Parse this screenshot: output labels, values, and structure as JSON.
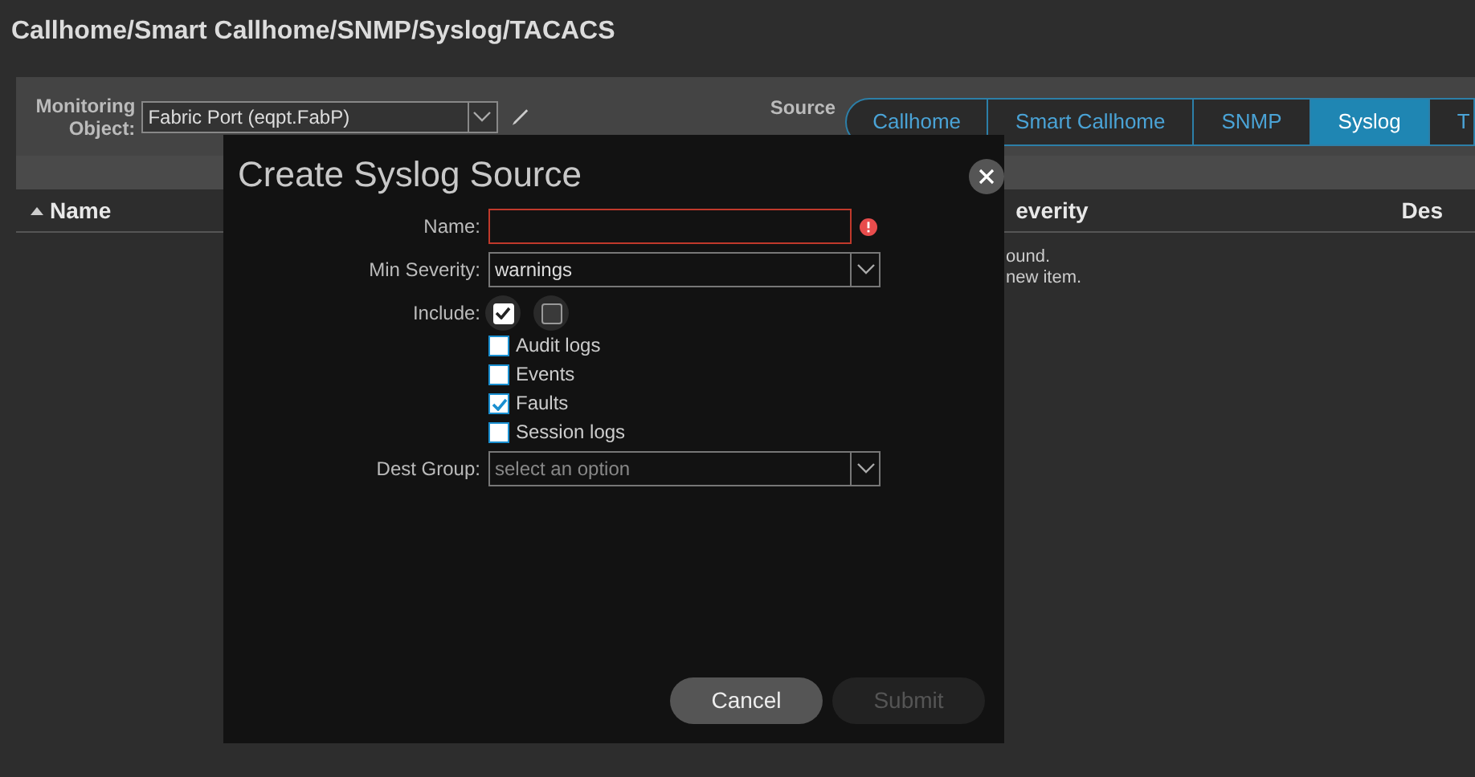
{
  "page_title": "Callhome/Smart Callhome/SNMP/Syslog/TACACS",
  "monitoring_object": {
    "label": "Monitoring Object:",
    "value": "Fabric Port (eqpt.FabP)"
  },
  "source_type": {
    "label": "Source",
    "tabs": [
      {
        "label": "Callhome",
        "selected": false
      },
      {
        "label": "Smart Callhome",
        "selected": false
      },
      {
        "label": "SNMP",
        "selected": false
      },
      {
        "label": "Syslog",
        "selected": true
      },
      {
        "label": "T",
        "selected": false
      }
    ]
  },
  "table": {
    "columns": [
      {
        "label": "Name",
        "sorted": true
      },
      {
        "label": "everity",
        "sorted": false
      },
      {
        "label": "Des",
        "sorted": false
      }
    ],
    "empty_message": [
      "ound.",
      "new item."
    ]
  },
  "dialog": {
    "title": "Create Syslog Source",
    "name": {
      "label": "Name:",
      "error": true
    },
    "min_severity": {
      "label": "Min Severity:",
      "value": "warnings"
    },
    "include": {
      "label": "Include:",
      "toggles": [
        {
          "checked": true
        },
        {
          "checked": false
        }
      ],
      "options": [
        {
          "label": "Audit logs",
          "checked": false
        },
        {
          "label": "Events",
          "checked": false
        },
        {
          "label": "Faults",
          "checked": true
        },
        {
          "label": "Session logs",
          "checked": false
        }
      ]
    },
    "dest_group": {
      "label": "Dest Group:",
      "placeholder": "select an option"
    },
    "buttons": [
      {
        "label": "Cancel",
        "disabled": false
      },
      {
        "label": "Submit",
        "disabled": true
      }
    ]
  }
}
